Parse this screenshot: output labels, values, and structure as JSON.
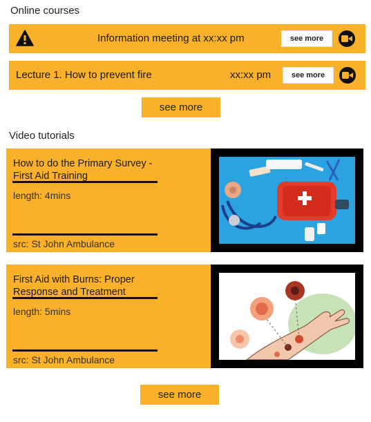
{
  "online_courses": {
    "title": "Online courses",
    "items": [
      {
        "icon": "warning-icon",
        "text": "Information meeting at xx:xx pm",
        "see_more": "see more",
        "action_icon": "video-camera-icon"
      },
      {
        "text": "Lecture 1. How to prevent fire",
        "time": "xx:xx pm",
        "see_more": "see more",
        "action_icon": "video-camera-icon"
      }
    ],
    "see_more": "see more"
  },
  "video_tutorials": {
    "title": "Video tutorials",
    "items": [
      {
        "title": "How to do the Primary Survey - First Aid Training",
        "length": "length: 4mins",
        "source": "src: St John Ambulance",
        "thumbnail": "first-aid-kit-image"
      },
      {
        "title": "First Aid with Burns: Proper Response and Treatment",
        "length": "length: 5mins",
        "source": "src: St John Ambulance",
        "thumbnail": "burn-degrees-illustration"
      }
    ],
    "see_more": "see more"
  },
  "colors": {
    "accent": "#f9b02a",
    "thumbnail_frame": "#000000"
  }
}
